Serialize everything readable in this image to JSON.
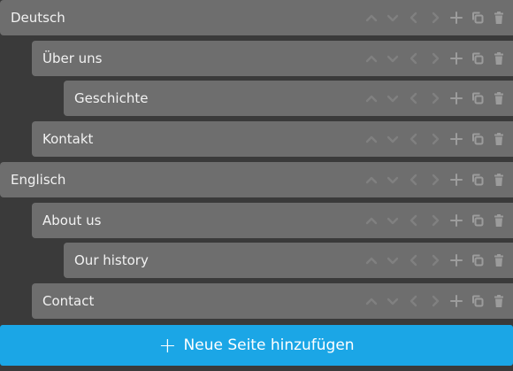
{
  "pages": [
    {
      "label": "Deutsch",
      "level": 0,
      "can_up": false,
      "can_down": false,
      "can_left": false,
      "can_right": false
    },
    {
      "label": "Über uns",
      "level": 1,
      "can_up": false,
      "can_down": false,
      "can_left": false,
      "can_right": false
    },
    {
      "label": "Geschichte",
      "level": 2,
      "can_up": false,
      "can_down": false,
      "can_left": false,
      "can_right": false
    },
    {
      "label": "Kontakt",
      "level": 1,
      "can_up": false,
      "can_down": false,
      "can_left": false,
      "can_right": false
    },
    {
      "label": "Englisch",
      "level": 0,
      "can_up": false,
      "can_down": false,
      "can_left": false,
      "can_right": false
    },
    {
      "label": "About us",
      "level": 1,
      "can_up": false,
      "can_down": false,
      "can_left": false,
      "can_right": false
    },
    {
      "label": "Our history",
      "level": 2,
      "can_up": false,
      "can_down": false,
      "can_left": false,
      "can_right": false
    },
    {
      "label": "Contact",
      "level": 1,
      "can_up": false,
      "can_down": false,
      "can_left": false,
      "can_right": false
    }
  ],
  "row_icons": [
    "chevron-up-icon",
    "chevron-down-icon",
    "chevron-left-icon",
    "chevron-right-icon",
    "plus-icon",
    "copy-icon",
    "trash-icon"
  ],
  "add_button": {
    "label": "Neue Seite hinzufügen",
    "icon": "plus-icon"
  },
  "colors": {
    "background": "#3a3a3a",
    "row": "#6e6e6e",
    "accent": "#1ba6e6",
    "text": "#f2f2f2"
  }
}
